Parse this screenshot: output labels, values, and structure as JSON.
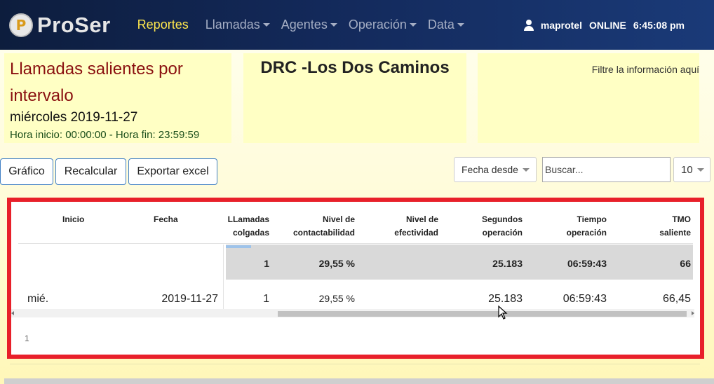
{
  "navbar": {
    "brand": "ProSer",
    "logo_letter": "P",
    "items": [
      {
        "label": "Reportes",
        "active": true,
        "dropdown": false
      },
      {
        "label": "Llamadas",
        "active": false,
        "dropdown": true
      },
      {
        "label": "Agentes",
        "active": false,
        "dropdown": true
      },
      {
        "label": "Operación",
        "active": false,
        "dropdown": true
      },
      {
        "label": "Data",
        "active": false,
        "dropdown": true
      }
    ],
    "user": "maprotel",
    "status": "ONLINE",
    "time": "6:45:08 pm"
  },
  "report": {
    "title": "Llamadas salientes por intervalo",
    "date": "miércoles 2019-11-27",
    "hours": "Hora inicio: 00:00:00 - Hora fin: 23:59:59",
    "site": "DRC -Los Dos Caminos",
    "filter_hint": "Filtre la información aquí"
  },
  "actions": {
    "grafico": "Gráfico",
    "recalcular": "Recalcular",
    "exportar": "Exportar excel",
    "date_select": "Fecha desde",
    "search_placeholder": "Buscar...",
    "page_size": "10"
  },
  "table": {
    "columns": [
      {
        "l1": "Inicio",
        "l2": ""
      },
      {
        "l1": "Fecha",
        "l2": ""
      },
      {
        "l1": "LLamadas",
        "l2": "colgadas"
      },
      {
        "l1": "Nivel de",
        "l2": "contactabilidad"
      },
      {
        "l1": "Nivel de",
        "l2": "efectividad"
      },
      {
        "l1": "Segundos",
        "l2": "operación"
      },
      {
        "l1": "Tiempo",
        "l2": "operación"
      },
      {
        "l1": "TMO",
        "l2": "saliente"
      }
    ],
    "summary": {
      "colgadas": "1",
      "contactabilidad": "29,55 %",
      "efectividad": "",
      "segundos": "25.183",
      "tiempo": "06:59:43",
      "tmo": "66"
    },
    "row": {
      "inicio": "mié.",
      "fecha": "2019-11-27",
      "colgadas": "1",
      "contactabilidad": "29,55 %",
      "efectividad": "",
      "segundos": "25.183",
      "tiempo": "06:59:43",
      "tmo": "66,45"
    },
    "pager": "1"
  }
}
